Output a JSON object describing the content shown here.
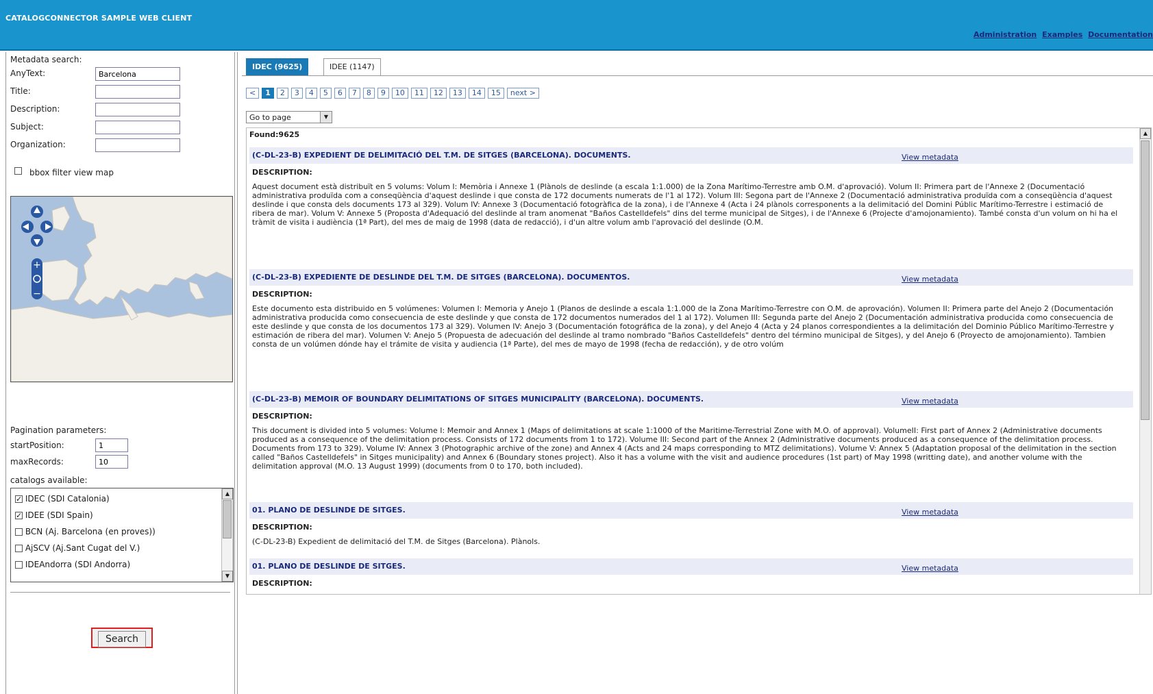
{
  "header": {
    "title": "CATALOGCONNECTOR SAMPLE WEB CLIENT",
    "links": [
      "Administration",
      "Examples",
      "Documentation"
    ]
  },
  "search": {
    "heading": "Metadata search:",
    "anytext_label": "AnyText:",
    "anytext_value": "Barcelona",
    "title_label": "Title:",
    "description_label": "Description:",
    "subject_label": "Subject:",
    "organization_label": "Organization:",
    "bbox_label": "bbox filter view map"
  },
  "pagination": {
    "heading": "Pagination parameters:",
    "start_label": "startPosition:",
    "start_value": "1",
    "max_label": "maxRecords:",
    "max_value": "10"
  },
  "catalogs": {
    "heading": "catalogs available:",
    "items": [
      {
        "label": "IDEC (SDI Catalonia)",
        "checked": true
      },
      {
        "label": "IDEE (SDI Spain)",
        "checked": true
      },
      {
        "label": "BCN (Aj. Barcelona (en proves))",
        "checked": false
      },
      {
        "label": "AjSCV (Aj.Sant Cugat del V.)",
        "checked": false
      },
      {
        "label": "IDEAndorra (SDI Andorra)",
        "checked": false
      }
    ]
  },
  "search_button": "Search",
  "tabs": [
    "IDEC (9625)",
    "IDEE (1147)"
  ],
  "pager": {
    "prev": "<",
    "pages": [
      "1",
      "2",
      "3",
      "4",
      "5",
      "6",
      "7",
      "8",
      "9",
      "10",
      "11",
      "12",
      "13",
      "14",
      "15"
    ],
    "current": "1",
    "next": "next >"
  },
  "goto": "Go to page",
  "found": "Found:9625",
  "records": [
    {
      "title": "(C-DL-23-B) EXPEDIENT DE DELIMITACIÓ DEL T.M. DE SITGES (BARCELONA). DOCUMENTS.",
      "link": "View metadata",
      "desc_label": "DESCRIPTION:",
      "desc": "Aquest document està distribuït en 5 volums: Volum I: Memòria i Annexe 1 (Plànols de deslinde (a escala 1:1.000) de la Zona Marítimo-Terrestre amb O.M. d'aprovació). Volum II: Primera part de l'Annexe 2 (Documentació administrativa produïda com a conseqüència d'aquest deslinde i que consta de 172 documents numerats de l'1 al 172). Volum III: Segona part de l'Annexe 2 (Documentació administrativa produïda com a conseqüència d'aquest deslinde i que consta dels documents 173 al 329). Volum IV: Annexe 3 (Documentació fotogràfica de la zona), i de l'Annexe 4 (Acta i 24 plànols corresponents a la delimitació del Domini Públic Marítimo-Terrestre i estimació de ribera de mar). Volum V: Annexe 5 (Proposta d'Adequació del deslinde al tram anomenat \"Baños Castelldefels\" dins del terme municipal de Sitges), i de l'Annexe 6 (Projecte d'amojonamiento). També consta d'un volum on hi ha el tràmit de visita i audiència (1ª Part), del mes de maig de 1998 (data de redacció), i d'un altre volum amb l'aprovació del deslinde (O.M."
    },
    {
      "title": "(C-DL-23-B) EXPEDIENTE DE DESLINDE DEL T.M. DE SITGES (BARCELONA). DOCUMENTOS.",
      "link": "View metadata",
      "desc_label": "DESCRIPTION:",
      "desc": "Este documento esta distribuido en 5 volúmenes: Volumen I: Memoria y Anejo 1 (Planos de deslinde a escala 1:1.000 de la Zona Marítimo-Terrestre con O.M. de aprovación). Volumen II: Primera parte del Anejo 2 (Documentación administrativa producida como consecuencia de este deslinde y que consta de 172 documentos numerados del 1 al 172). Volumen III: Segunda parte del Anejo 2 (Documentación administrativa producida como consecuencia de este deslinde y que consta de los documentos 173 al 329). Volumen IV: Anejo 3 (Documentación fotográfica de la zona), y del Anejo 4 (Acta y 24 planos correspondientes a la delimitación del Dominio Público Marítimo-Terrestre y estimación de ribera del mar). Volumen V: Anejo 5 (Propuesta de adecuación del deslinde al tramo nombrado \"Baños Castelldefels\" dentro del término municipal de Sitges), y del Anejo 6 (Proyecto de amojonamiento). Tambien consta de un volúmen dónde hay el trámite de visita y audiencia (1ª Parte), del mes de mayo de 1998 (fecha de redacción), y de otro volúm"
    },
    {
      "title": "(C-DL-23-B) MEMOIR OF BOUNDARY DELIMITATIONS OF SITGES MUNICIPALITY (BARCELONA). DOCUMENTS.",
      "link": "View metadata",
      "desc_label": "DESCRIPTION:",
      "desc": "This document is divided into 5 volumes: Volume I: Memoir and Annex 1 (Maps of delimitations at scale 1:1000 of the Maritime-Terrestrial Zone with M.O. of approval). VolumeII: First part of Annex 2 (Administrative documents produced as a consequence of the delimitation process. Consists of 172 documents from 1 to 172). Volume III: Second part of the Annex 2 (Administrative documents produced as a consequence of the delimitation process. Documents from 173 to 329). Volume IV: Annex 3 (Photographic archive of the zone) and Annex 4 (Acts and 24 maps corresponding to MTZ delimitations). Volume V: Annex 5 (Adaptation proposal of the delimitation in the section called \"Baños Castelldefels\" in Sitges municipality) and Annex 6 (Boundary stones project). Also it has a volume with the visit and audience procedures (1st part) of May 1998 (writting date), and another volume with the delimitation approval (M.O. 13 August 1999) (documents from 0 to 170, both included)."
    },
    {
      "title": "01. PLANO DE DESLINDE DE SITGES.",
      "link": "View metadata",
      "desc_label": "DESCRIPTION:",
      "desc": "(C-DL-23-B) Expedient de delimitació del T.M. de Sitges (Barcelona). Plànols."
    },
    {
      "title": "01. PLANO DE DESLINDE DE SITGES.",
      "link": "View metadata",
      "desc_label": "DESCRIPTION:",
      "desc": ""
    }
  ],
  "colors": {
    "header_bg": "#1994cc",
    "active_tab": "#1a7ab5",
    "link": "#1a2a7a",
    "search_highlight": "#e02020"
  }
}
